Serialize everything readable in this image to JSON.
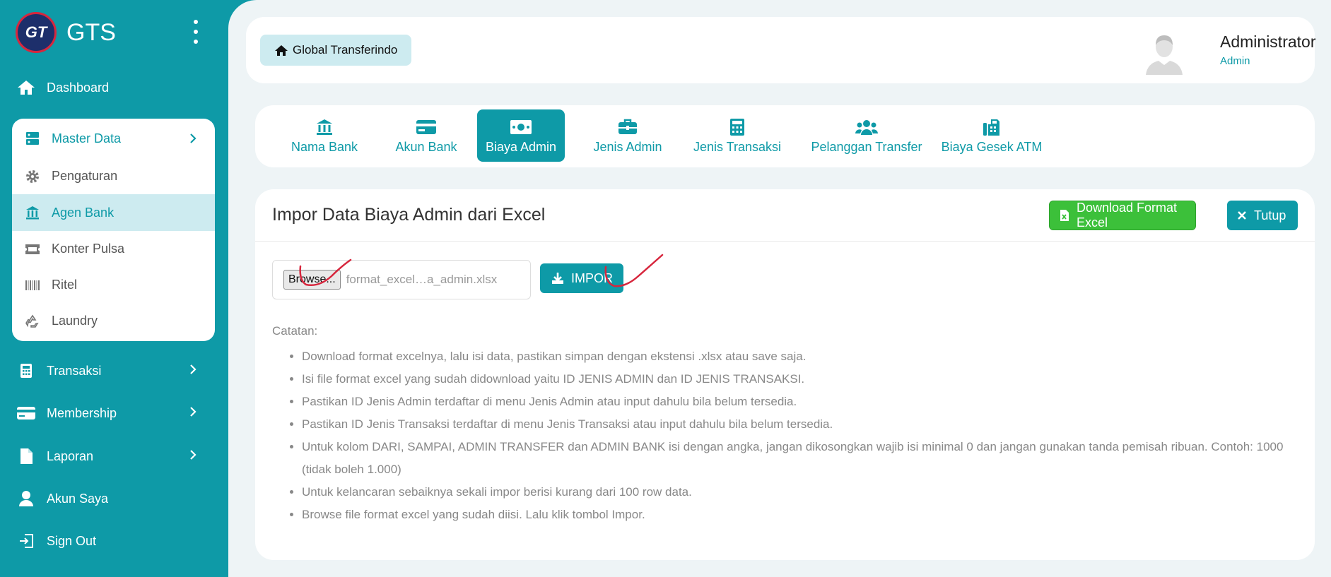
{
  "brand": {
    "name": "GTS",
    "logo_text": "GT"
  },
  "sidebar": {
    "dashboard": "Dashboard",
    "master_data": {
      "label": "Master Data",
      "items": [
        {
          "label": "Pengaturan",
          "icon": "gear-icon"
        },
        {
          "label": "Agen Bank",
          "icon": "bank-icon",
          "active": true
        },
        {
          "label": "Konter Pulsa",
          "icon": "ticket-icon"
        },
        {
          "label": "Ritel",
          "icon": "barcode-icon"
        },
        {
          "label": "Laundry",
          "icon": "recycle-icon"
        }
      ]
    },
    "transaksi": "Transaksi",
    "membership": "Membership",
    "laporan": "Laporan",
    "akun_saya": "Akun Saya",
    "sign_out": "Sign Out"
  },
  "header": {
    "breadcrumb": "Global Transferindo",
    "user_name": "Administrator",
    "user_role": "Admin"
  },
  "tabs": [
    {
      "label": "Nama Bank",
      "icon": "bank-icon"
    },
    {
      "label": "Akun Bank",
      "icon": "credit-card-icon"
    },
    {
      "label": "Biaya Admin",
      "icon": "money-bill-icon",
      "active": true
    },
    {
      "label": "Jenis Admin",
      "icon": "briefcase-icon"
    },
    {
      "label": "Jenis Transaksi",
      "icon": "calculator-icon"
    },
    {
      "label": "Pelanggan Transfer",
      "icon": "users-icon"
    },
    {
      "label": "Biaya Gesek ATM",
      "icon": "fax-icon"
    }
  ],
  "card": {
    "title": "Impor Data Biaya Admin dari Excel",
    "download_label": "Download Format Excel",
    "close_label": "Tutup",
    "browse_label": "Browse...",
    "file_name": "format_excel…a_admin.xlsx",
    "import_label": "IMPOR",
    "notes_title": "Catatan:",
    "notes": [
      "Download format excelnya, lalu isi data, pastikan simpan dengan ekstensi .xlsx atau save saja.",
      "Isi file format excel yang sudah didownload yaitu ID JENIS ADMIN dan ID JENIS TRANSAKSI.",
      "Pastikan ID Jenis Admin terdaftar di menu Jenis Admin atau input dahulu bila belum tersedia.",
      "Pastikan ID Jenis Transaksi terdaftar di menu Jenis Transaksi atau input dahulu bila belum tersedia.",
      "Untuk kolom DARI, SAMPAI, ADMIN TRANSFER dan ADMIN BANK isi dengan angka, jangan dikosongkan wajib isi minimal 0 dan jangan gunakan tanda pemisah ribuan. Contoh: 1000 (tidak boleh 1.000)",
      "Untuk kelancaran sebaiknya sekali impor berisi kurang dari 100 row data.",
      "Browse file format excel yang sudah diisi. Lalu klik tombol Impor."
    ]
  },
  "colors": {
    "accent": "#0e9aa7",
    "success": "#3cc03a",
    "annotation": "#d7263d"
  }
}
